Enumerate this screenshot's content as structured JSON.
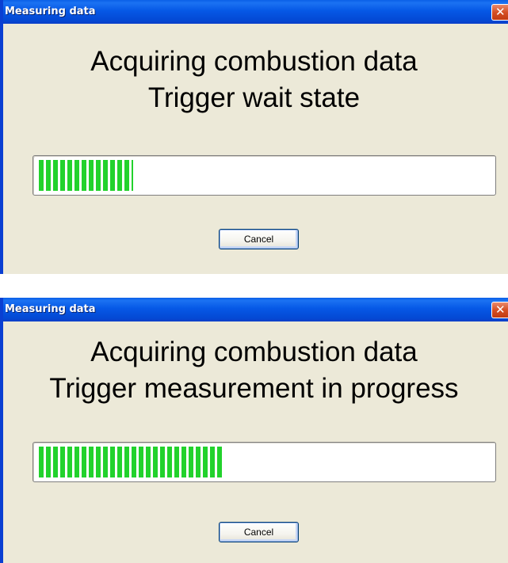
{
  "dialogs": [
    {
      "title": "Measuring data",
      "message_line1": "Acquiring combustion data",
      "message_line2": "Trigger wait state",
      "progress_fraction": 0.21,
      "cancel_label": "Cancel",
      "close_icon": "close-icon"
    },
    {
      "title": "Measuring data",
      "message_line1": "Acquiring combustion data",
      "message_line2": "Trigger measurement in progress",
      "progress_fraction": 0.41,
      "cancel_label": "Cancel",
      "close_icon": "close-icon"
    }
  ],
  "colors": {
    "titlebar": "#0458e6",
    "window_border": "#0a3fd2",
    "dialog_background": "#ece9d8",
    "progress_fill": "#22d22c",
    "close_button": "#d64f24"
  }
}
